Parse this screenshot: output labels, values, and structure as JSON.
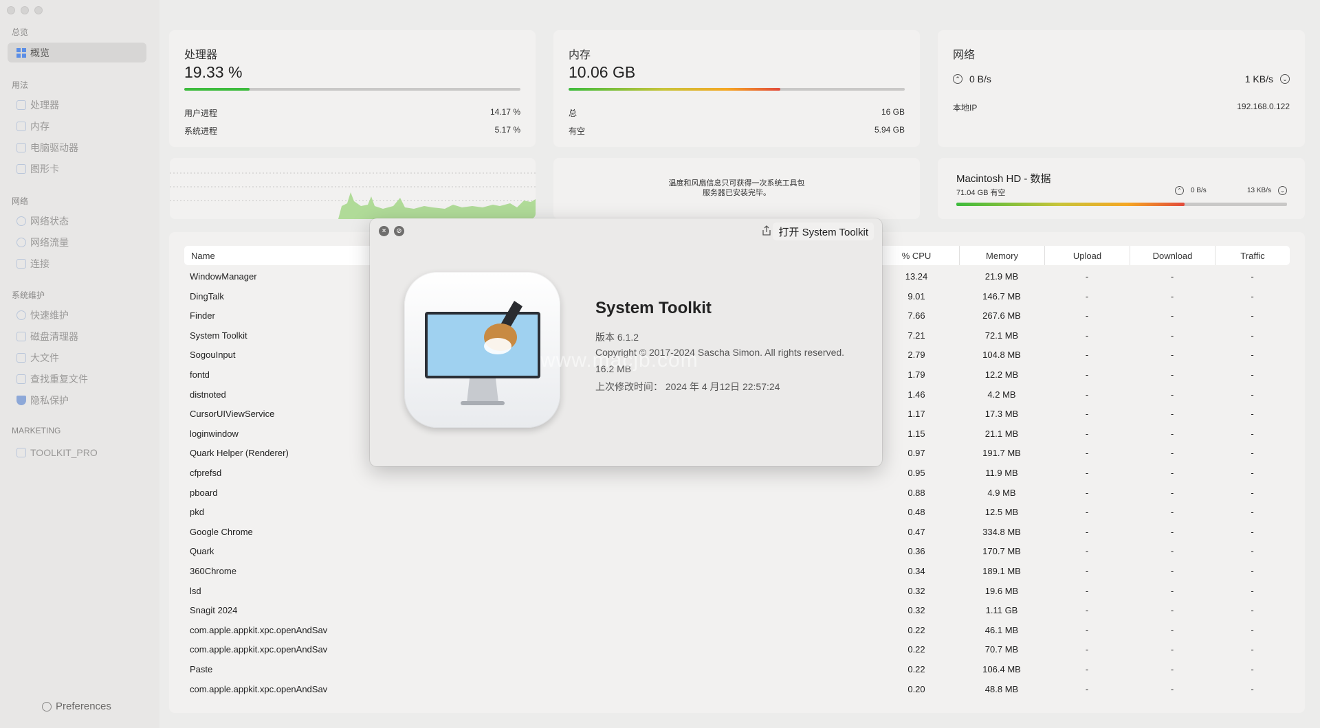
{
  "sidebar": {
    "sections": [
      {
        "title": "总览",
        "items": [
          {
            "label": "概览",
            "icon": "grid-icon",
            "active": true
          }
        ]
      },
      {
        "title": "用法",
        "items": [
          {
            "label": "处理器",
            "icon": "cpu-icon"
          },
          {
            "label": "内存",
            "icon": "memory-icon"
          },
          {
            "label": "电脑驱动器",
            "icon": "drive-icon"
          },
          {
            "label": "图形卡",
            "icon": "gpu-icon"
          }
        ]
      },
      {
        "title": "网络",
        "items": [
          {
            "label": "网络状态",
            "icon": "globe-icon"
          },
          {
            "label": "网络流量",
            "icon": "cloud-icon"
          },
          {
            "label": "连接",
            "icon": "monitor-icon"
          }
        ]
      },
      {
        "title": "系统维护",
        "items": [
          {
            "label": "快速维护",
            "icon": "clock-icon"
          },
          {
            "label": "磁盘清理器",
            "icon": "broom-icon"
          },
          {
            "label": "大文件",
            "icon": "file-icon"
          },
          {
            "label": "查找重复文件",
            "icon": "duplicate-icon"
          },
          {
            "label": "隐私保护",
            "icon": "shield-icon"
          }
        ]
      },
      {
        "title": "MARKETING",
        "items": [
          {
            "label": "TOOLKIT_PRO",
            "icon": "book-icon"
          }
        ]
      }
    ],
    "preferences": "Preferences"
  },
  "cpu": {
    "title": "处理器",
    "value": "19.33 %",
    "fill": 0.1933,
    "user_label": "用户进程",
    "user_value": "14.17 %",
    "system_label": "系统进程",
    "system_value": "5.17 %"
  },
  "memory": {
    "title": "内存",
    "value": "10.06 GB",
    "fill": 0.63,
    "total_label": "总",
    "total_value": "16 GB",
    "free_label": "有空",
    "free_value": "5.94 GB"
  },
  "network": {
    "title": "网络",
    "upload": "0 B/s",
    "download": "1 KB/s",
    "ip_label": "本地IP",
    "ip_value": "192.168.0.122"
  },
  "sensors": {
    "line1": "温度和风扇信息只可获得一次系统工具包",
    "line2": "服务器已安装完毕。"
  },
  "disk": {
    "title": "Macintosh HD - 数据",
    "free": "71.04 GB 有空",
    "read": "0 B/s",
    "write": "13 KB/s",
    "fill": 0.69
  },
  "table": {
    "columns": [
      "Name",
      "% CPU",
      "Memory",
      "Upload",
      "Download",
      "Traffic"
    ],
    "rows": [
      {
        "name": "WindowManager",
        "cpu": "13.24",
        "mem": "21.9 MB",
        "up": "-",
        "down": "-",
        "traffic": "-"
      },
      {
        "name": "DingTalk",
        "cpu": "9.01",
        "mem": "146.7 MB",
        "up": "-",
        "down": "-",
        "traffic": "-"
      },
      {
        "name": "Finder",
        "cpu": "7.66",
        "mem": "267.6 MB",
        "up": "-",
        "down": "-",
        "traffic": "-"
      },
      {
        "name": "System Toolkit",
        "cpu": "7.21",
        "mem": "72.1 MB",
        "up": "-",
        "down": "-",
        "traffic": "-"
      },
      {
        "name": "SogouInput",
        "cpu": "2.79",
        "mem": "104.8 MB",
        "up": "-",
        "down": "-",
        "traffic": "-"
      },
      {
        "name": "fontd",
        "cpu": "1.79",
        "mem": "12.2 MB",
        "up": "-",
        "down": "-",
        "traffic": "-"
      },
      {
        "name": "distnoted",
        "cpu": "1.46",
        "mem": "4.2 MB",
        "up": "-",
        "down": "-",
        "traffic": "-"
      },
      {
        "name": "CursorUIViewService",
        "cpu": "1.17",
        "mem": "17.3 MB",
        "up": "-",
        "down": "-",
        "traffic": "-"
      },
      {
        "name": "loginwindow",
        "cpu": "1.15",
        "mem": "21.1 MB",
        "up": "-",
        "down": "-",
        "traffic": "-"
      },
      {
        "name": "Quark Helper (Renderer)",
        "cpu": "0.97",
        "mem": "191.7 MB",
        "up": "-",
        "down": "-",
        "traffic": "-"
      },
      {
        "name": "cfprefsd",
        "cpu": "0.95",
        "mem": "11.9 MB",
        "up": "-",
        "down": "-",
        "traffic": "-"
      },
      {
        "name": "pboard",
        "cpu": "0.88",
        "mem": "4.9 MB",
        "up": "-",
        "down": "-",
        "traffic": "-"
      },
      {
        "name": "pkd",
        "cpu": "0.48",
        "mem": "12.5 MB",
        "up": "-",
        "down": "-",
        "traffic": "-"
      },
      {
        "name": "Google Chrome",
        "cpu": "0.47",
        "mem": "334.8 MB",
        "up": "-",
        "down": "-",
        "traffic": "-"
      },
      {
        "name": "Quark",
        "cpu": "0.36",
        "mem": "170.7 MB",
        "up": "-",
        "down": "-",
        "traffic": "-"
      },
      {
        "name": "360Chrome",
        "cpu": "0.34",
        "mem": "189.1 MB",
        "up": "-",
        "down": "-",
        "traffic": "-"
      },
      {
        "name": "lsd",
        "cpu": "0.32",
        "mem": "19.6 MB",
        "up": "-",
        "down": "-",
        "traffic": "-"
      },
      {
        "name": "Snagit 2024",
        "cpu": "0.32",
        "mem": "1.11 GB",
        "up": "-",
        "down": "-",
        "traffic": "-"
      },
      {
        "name": "com.apple.appkit.xpc.openAndSav",
        "cpu": "0.22",
        "mem": "46.1 MB",
        "up": "-",
        "down": "-",
        "traffic": "-"
      },
      {
        "name": "com.apple.appkit.xpc.openAndSav",
        "cpu": "0.22",
        "mem": "70.7 MB",
        "up": "-",
        "down": "-",
        "traffic": "-"
      },
      {
        "name": "Paste",
        "cpu": "0.22",
        "mem": "106.4 MB",
        "up": "-",
        "down": "-",
        "traffic": "-"
      },
      {
        "name": "com.apple.appkit.xpc.openAndSav",
        "cpu": "0.20",
        "mem": "48.8 MB",
        "up": "-",
        "down": "-",
        "traffic": "-"
      }
    ]
  },
  "dialog": {
    "open_button": "打开 System Toolkit",
    "app_name": "System Toolkit",
    "version": "版本 6.1.2",
    "copyright": "Copyright © 2017-2024 Sascha Simon. All rights reserved.",
    "size": "16.2 MB",
    "modified": "上次修改时间： 2024 年 4 月12日 22:57:24",
    "watermark": "www.macjb.com"
  },
  "colors": {
    "accent": "#5b8ee6",
    "green": "#3dbb3d",
    "orange": "#f5a623",
    "red": "#e24a3b"
  }
}
